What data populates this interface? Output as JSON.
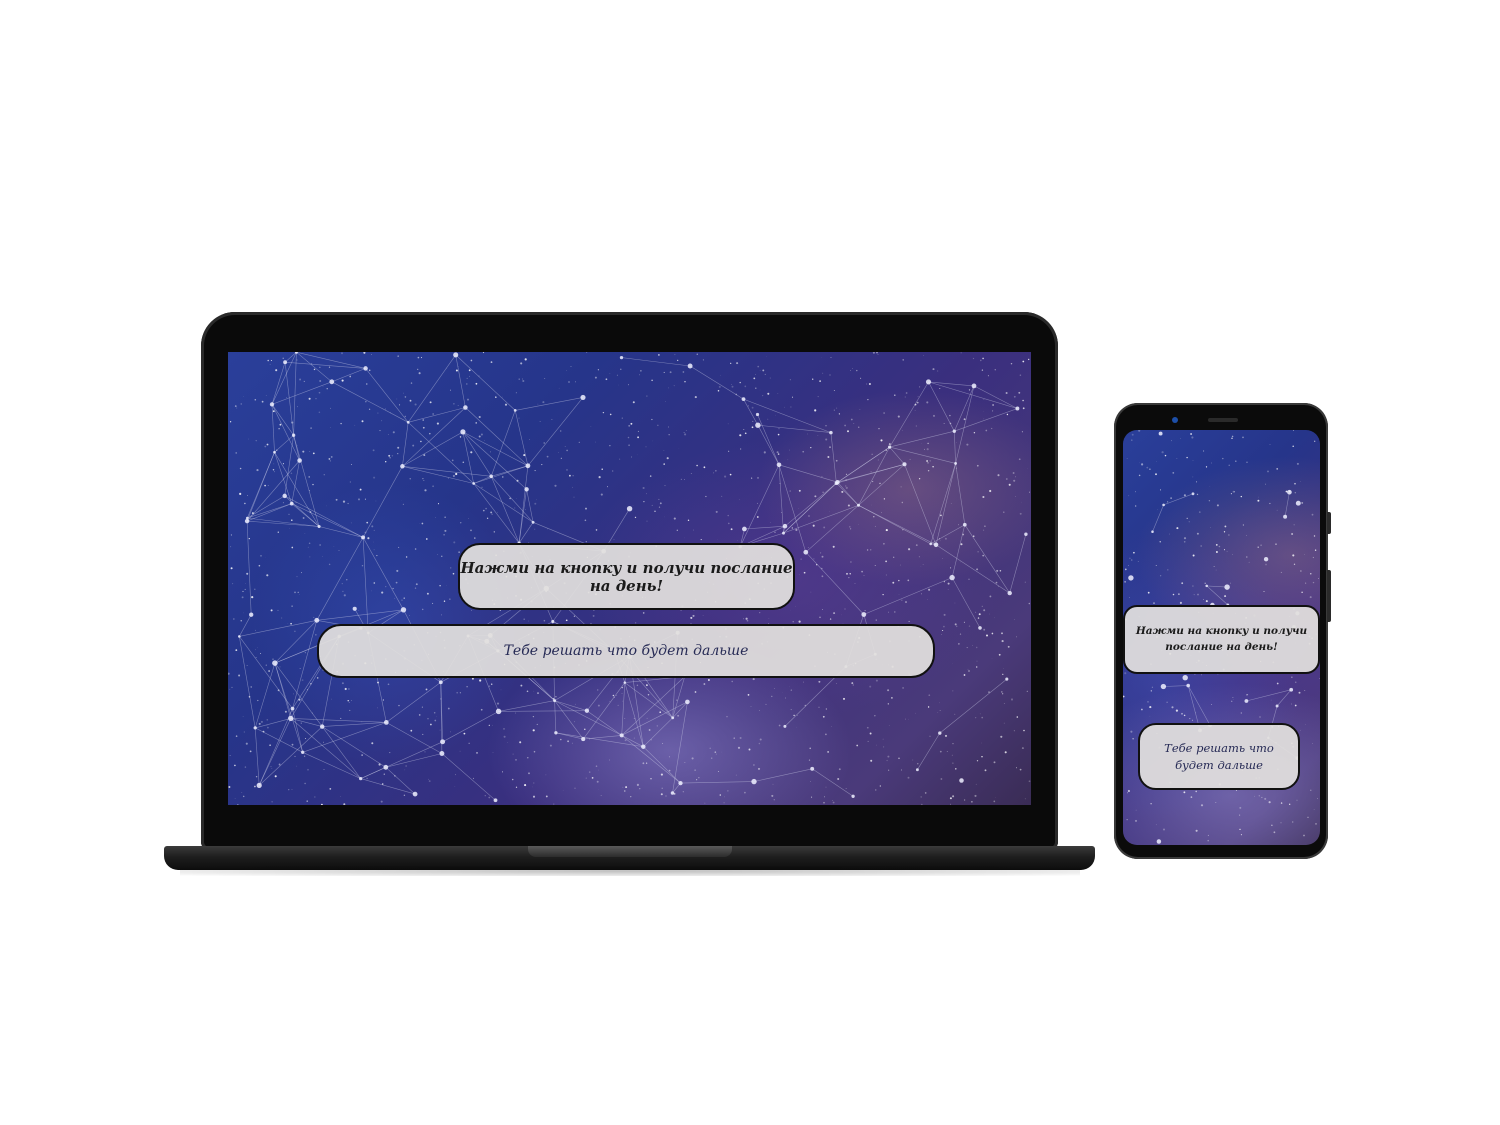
{
  "laptop": {
    "message_button_label": "Нажми на кнопку и получи послание на день!",
    "next_button_label": "Тебе решать что будет дальше"
  },
  "phone": {
    "message_button_label": "Нажми на кнопку и получи послание на день!",
    "next_button_label": "Тебе решать что будет дальше"
  },
  "colors": {
    "background_deep_blue": "#26358a",
    "background_violet": "#4a3a7a",
    "pill_fill": "#e2e0de",
    "pill_border": "#111111",
    "next_text": "#262a55",
    "device_frame": "#0a0a0a"
  }
}
